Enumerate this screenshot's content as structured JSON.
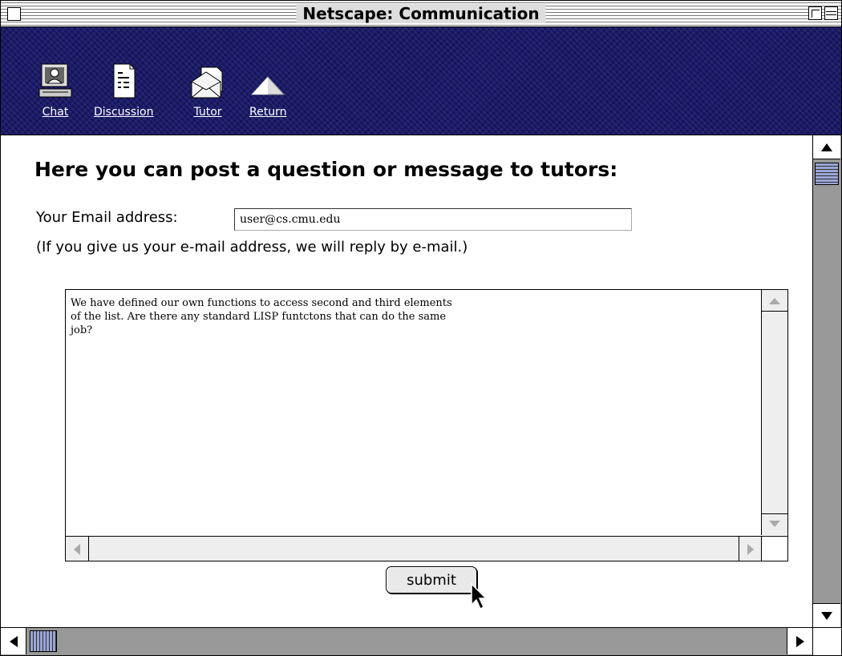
{
  "window": {
    "title": "Netscape: Communication"
  },
  "nav": {
    "items": [
      {
        "label": "Chat",
        "icon": "person-at-computer-icon"
      },
      {
        "label": "Discussion",
        "icon": "document-icon"
      },
      {
        "label": "Tutor",
        "icon": "mail-envelope-icon"
      },
      {
        "label": "Return",
        "icon": "triangle-up-icon"
      }
    ]
  },
  "main": {
    "heading": "Here you can post a question or message to tutors:",
    "email_label": "Your Email address:",
    "email_value": "user@cs.cmu.edu",
    "email_note": "(If you give us your e-mail address, we will reply by e-mail.)",
    "message_text": "We have defined our own functions to access second and third elements\nof the list. Are there any standard LISP funtctons that can do the same\njob?",
    "submit_label": "submit"
  },
  "colors": {
    "navbar": "#1b1a6b",
    "scrollbar_track": "#999999",
    "scroll_thumb": "#9aa6d6"
  }
}
